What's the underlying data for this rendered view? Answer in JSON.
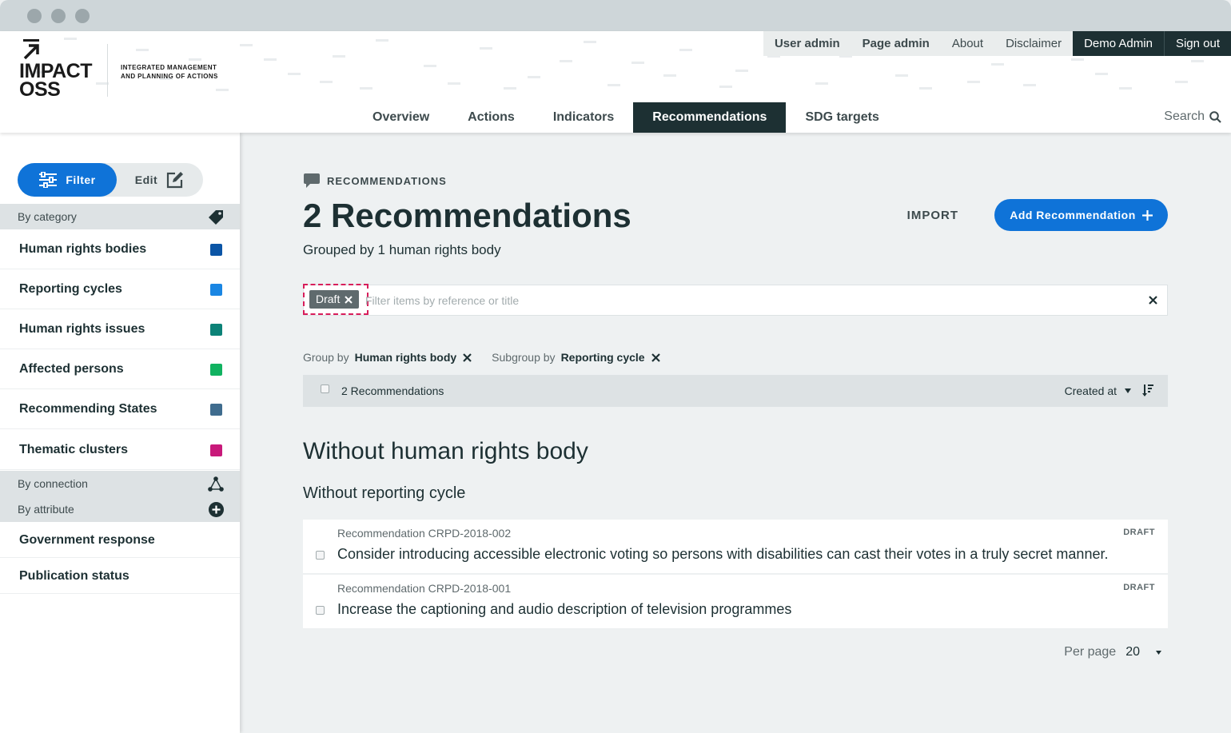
{
  "header": {
    "logo_line1": "IMPACT",
    "logo_line2": "OSS",
    "claim_line1": "INTEGRATED MANAGEMENT",
    "claim_line2": "AND PLANNING OF ACTIONS",
    "top_nav": [
      "User admin",
      "Page admin",
      "About",
      "Disclaimer",
      "Demo Admin",
      "Sign out"
    ],
    "main_nav": [
      "Overview",
      "Actions",
      "Indicators",
      "Recommendations",
      "SDG targets"
    ],
    "active_tab": "Recommendations",
    "search_label": "Search"
  },
  "sidebar": {
    "filter_label": "Filter",
    "edit_label": "Edit",
    "by_category": "By category",
    "categories": [
      {
        "label": "Human rights bodies",
        "color": "#0b55a6"
      },
      {
        "label": "Reporting cycles",
        "color": "#1a86e3"
      },
      {
        "label": "Human rights issues",
        "color": "#0c8277"
      },
      {
        "label": "Affected persons",
        "color": "#10b260"
      },
      {
        "label": "Recommending States",
        "color": "#3f6c8e"
      },
      {
        "label": "Thematic clusters",
        "color": "#c8197a"
      }
    ],
    "by_connection": "By connection",
    "by_attribute": "By attribute",
    "attributes": [
      "Government response",
      "Publication status"
    ]
  },
  "main": {
    "kicker": "RECOMMENDATIONS",
    "title": "2 Recommendations",
    "subtitle": "Grouped by 1 human rights body",
    "import_label": "IMPORT",
    "add_label": "Add Recommendation",
    "filter_chip": "Draft",
    "search_placeholder": "Filter items by reference or title",
    "group_by_label": "Group by",
    "group_by_value": "Human rights body",
    "subgroup_label": "Subgroup by",
    "subgroup_value": "Reporting cycle",
    "list_count": "2 Recommendations",
    "sort_label": "Created at",
    "group_heading": "Without human rights body",
    "subgroup_heading": "Without reporting cycle",
    "items": [
      {
        "ref": "Recommendation CRPD-2018-002",
        "title": "Consider introducing accessible electronic voting so persons with disabilities can cast their votes in a truly secret manner.",
        "status": "DRAFT"
      },
      {
        "ref": "Recommendation CRPD-2018-001",
        "title": "Increase the captioning and audio description of television programmes",
        "status": "DRAFT"
      }
    ],
    "per_page_label": "Per page",
    "per_page_value": "20"
  },
  "colors": {
    "primary": "#0f73d8",
    "dark": "#1d3033",
    "highlight": "#d81e5b"
  }
}
